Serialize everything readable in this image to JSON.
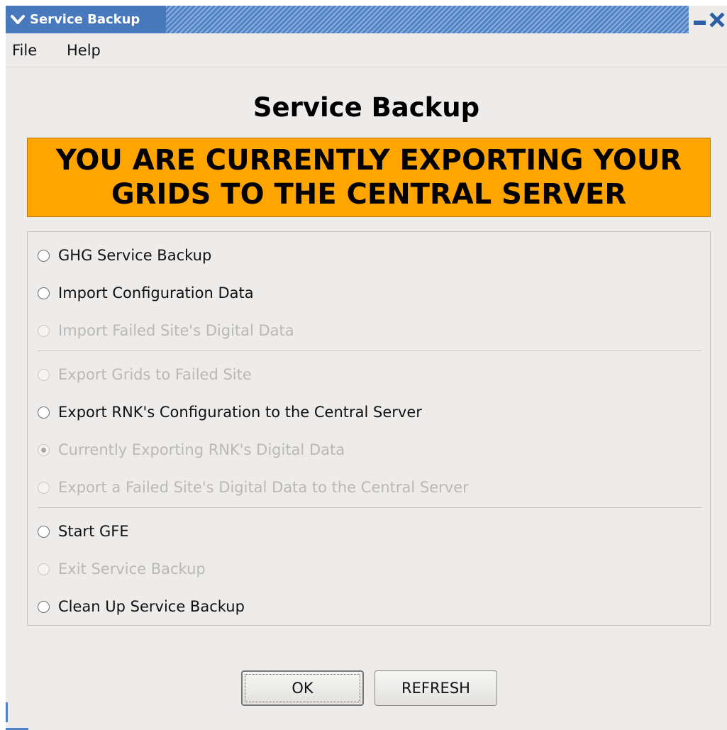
{
  "window": {
    "title": "Service Backup"
  },
  "menubar": {
    "items": [
      {
        "label": "File"
      },
      {
        "label": "Help"
      }
    ]
  },
  "main": {
    "heading": "Service Backup",
    "banner": {
      "line1": "YOU ARE CURRENTLY EXPORTING YOUR",
      "line2": "GRIDS TO THE CENTRAL SERVER",
      "color": "#ffa500"
    },
    "options": [
      {
        "label": "GHG Service Backup",
        "enabled": true,
        "selected": false
      },
      {
        "label": "Import Configuration Data",
        "enabled": true,
        "selected": false
      },
      {
        "label": "Import Failed Site's Digital Data",
        "enabled": false,
        "selected": false
      },
      {
        "label": "Export Grids to Failed Site",
        "enabled": false,
        "selected": false
      },
      {
        "label": "Export RNK's Configuration to the Central Server",
        "enabled": true,
        "selected": false
      },
      {
        "label": "Currently Exporting RNK's Digital Data",
        "enabled": false,
        "selected": true
      },
      {
        "label": "Export a Failed Site's Digital Data to the Central Server",
        "enabled": false,
        "selected": false
      },
      {
        "label": "Start GFE",
        "enabled": true,
        "selected": false
      },
      {
        "label": "Exit Service Backup",
        "enabled": false,
        "selected": false
      },
      {
        "label": "Clean Up Service Backup",
        "enabled": true,
        "selected": false
      }
    ]
  },
  "buttons": {
    "ok_label": "OK",
    "refresh_label": "REFRESH"
  }
}
